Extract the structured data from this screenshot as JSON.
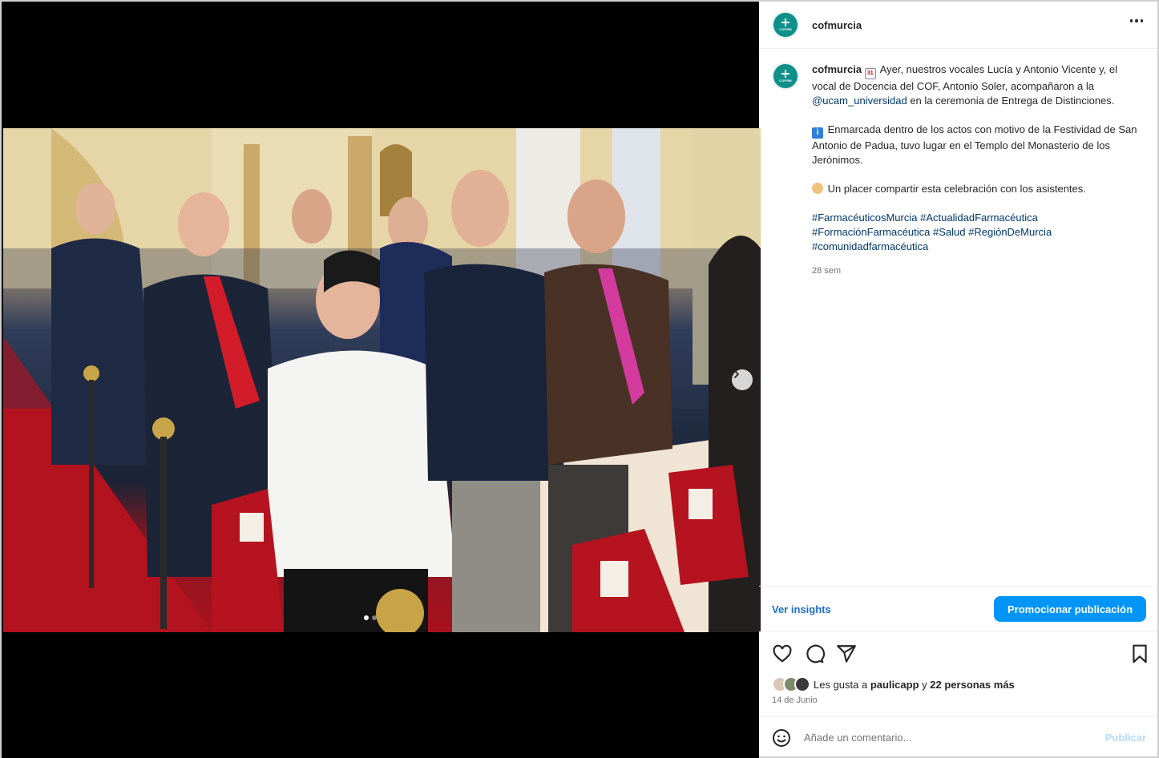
{
  "post": {
    "username": "cofmurcia",
    "avatar_icon": "cofrm-logo",
    "avatar_text": "COFRM",
    "caption": {
      "line1_text": "Ayer, nuestros vocales Lucía y Antonio Vicente y, el vocal de Docencia del COF, Antonio Soler, acompañaron a la",
      "mention": "@ucam_universidad",
      "line1_tail": "en la ceremonia de Entrega de Distinciones.",
      "para2": "Enmarcada dentro de los actos con motivo de la Festividad de San Antonio de Padua, tuvo lugar en el Templo del Monasterio de los Jerónimos.",
      "para3": "Un placer compartir esta celebración con los asistentes.",
      "hashtags": [
        "#FarmacéuticosMurcia",
        "#ActualidadFarmacéutica",
        "#FormaciónFarmacéutica",
        "#Salud",
        "#RegiónDeMurcia",
        "#comunidadfarmacéutica"
      ],
      "time_ago": "28 sem",
      "emoji_calendar": "calendar-emoji",
      "emoji_info": "info-emoji",
      "emoji_hands": "handshake-emoji",
      "calendar_text": "31",
      "info_text": "i"
    },
    "insights_label": "Ver insights",
    "promote_label": "Promocionar publicación",
    "likes": {
      "prefix": "Les gusta a",
      "user": "paulicapp",
      "connector": "y",
      "others": "22 personas más"
    },
    "date": "14 de Junio",
    "comment_placeholder": "Añade un comentario...",
    "publish_label": "Publicar"
  },
  "carousel": {
    "total_slides": 2,
    "current_slide": 1
  },
  "colors": {
    "accent": "#0095f6",
    "link": "#00376b",
    "avatar_bg": "#0e8f8a"
  }
}
